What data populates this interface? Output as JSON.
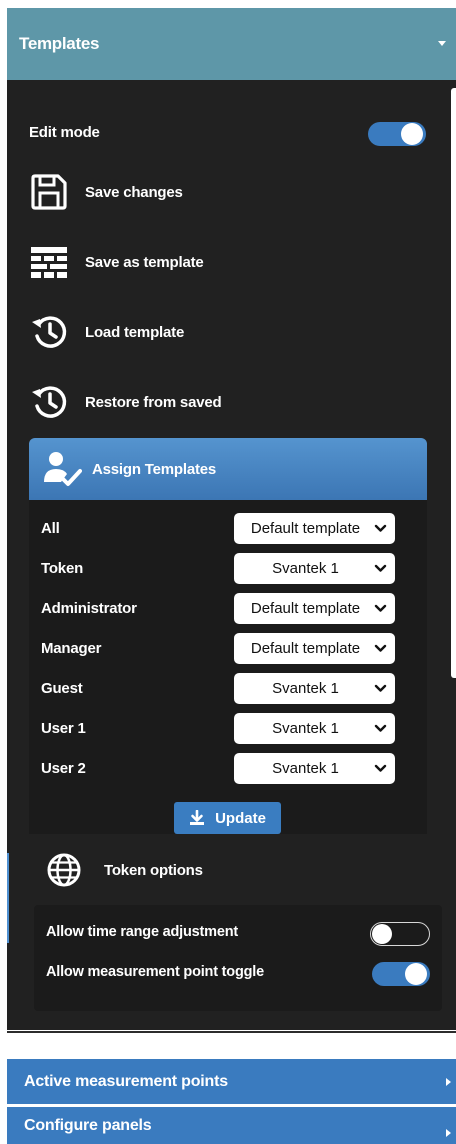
{
  "header": {
    "title": "Templates"
  },
  "edit_mode": {
    "label": "Edit mode",
    "enabled": true
  },
  "menu": [
    {
      "label": "Save changes",
      "icon": "floppy-disk-icon"
    },
    {
      "label": "Save as template",
      "icon": "template-grid-icon"
    },
    {
      "label": "Load template",
      "icon": "history-clock-icon"
    },
    {
      "label": "Restore from saved",
      "icon": "history-clock-icon"
    }
  ],
  "assign": {
    "title": "Assign Templates",
    "icon": "user-check-icon",
    "rows": [
      {
        "role": "All",
        "value": "Default template"
      },
      {
        "role": "Token",
        "value": "Svantek 1"
      },
      {
        "role": "Administrator",
        "value": "Default template"
      },
      {
        "role": "Manager",
        "value": "Default template"
      },
      {
        "role": "Guest",
        "value": "Svantek 1"
      },
      {
        "role": "User 1",
        "value": "Svantek 1"
      },
      {
        "role": "User 2",
        "value": "Svantek 1"
      }
    ],
    "update_label": "Update"
  },
  "token": {
    "title": "Token options",
    "icon": "globe-icon",
    "options": [
      {
        "label": "Allow time range adjustment",
        "enabled": false
      },
      {
        "label": "Allow measurement point toggle",
        "enabled": true
      }
    ]
  },
  "sections": [
    {
      "label": "Active measurement points"
    },
    {
      "label": "Configure panels"
    }
  ],
  "colors": {
    "header_bg": "#5e97a8",
    "panel_bg": "#212121",
    "accent_blue": "#3a7bbf",
    "section_bg": "#3a7bbf"
  }
}
